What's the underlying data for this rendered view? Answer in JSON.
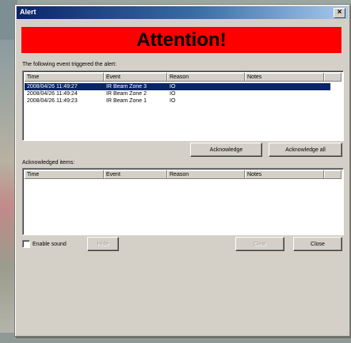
{
  "window": {
    "title": "Alert",
    "close_glyph": "×"
  },
  "banner": {
    "text": "Attention!",
    "color": "#ff0000"
  },
  "triggered": {
    "label": "The following event triggered the alert:",
    "columns": [
      "Time",
      "Event",
      "Reason",
      "Notes"
    ],
    "rows": [
      {
        "time": "2008/04/26 11:49:27",
        "event": "IR Beam Zone 3",
        "reason": "IO",
        "notes": "",
        "selected": true
      },
      {
        "time": "2008/04/26 11:49:24",
        "event": "IR Beam Zone 2",
        "reason": "IO",
        "notes": "",
        "selected": false
      },
      {
        "time": "2008/04/26 11:49:23",
        "event": "IR Beam Zone 1",
        "reason": "IO",
        "notes": "",
        "selected": false
      }
    ]
  },
  "buttons": {
    "acknowledge": "Acknowledge",
    "acknowledge_all": "Acknowledge all",
    "hide": "Hide",
    "clear": "Clear",
    "close": "Close"
  },
  "acknowledged": {
    "label": "Acknowledged items:",
    "columns": [
      "Time",
      "Event",
      "Reason",
      "Notes"
    ]
  },
  "enable_sound": {
    "label": "Enable sound",
    "checked": false
  },
  "colors": {
    "selection": "#0a246a",
    "title_bar": "#0a246a"
  }
}
